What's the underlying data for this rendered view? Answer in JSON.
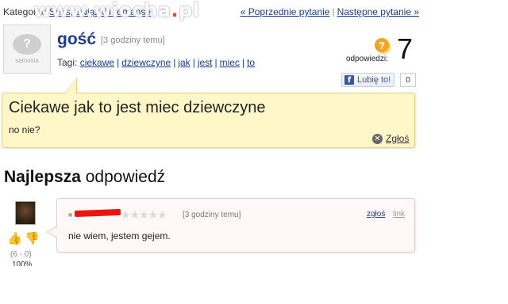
{
  "header": {
    "category_label": "Kategoria:",
    "category_link": "Seks, związki i romanse",
    "prev_link": "« Poprzednie pytanie",
    "next_link": "Następne pytanie »",
    "separator": "|"
  },
  "watermark": {
    "brand": "www.wiocha",
    "dot": ".",
    "tld": "pl"
  },
  "question": {
    "avatar_brand": "samosia",
    "author": "gość",
    "time": "[3 godziny temu]",
    "tags_label": "Tagi:",
    "tags": [
      "ciekawe",
      "dziewczyne",
      "jak",
      "jest",
      "miec",
      "to"
    ],
    "answers_label": "odpowiedzi:",
    "answers_icon_glyph": "?",
    "answers_count": "7",
    "like_label": "Lubię to!",
    "like_icon_glyph": "f",
    "like_count": "0",
    "title": "Ciekawe jak to jest miec dziewczyne",
    "body": "no nie?",
    "report_label": "Zgłoś",
    "report_icon_glyph": "✕"
  },
  "best_answer": {
    "heading_bold": "Najlepsza",
    "heading_rest": " odpowiedź",
    "time": "[3 godziny temu]",
    "stars": "★★★★★",
    "report_label": "zgłoś",
    "link_label": "link",
    "text": "nie wiem, jestem gejem.",
    "votes": "(6 - 0)",
    "percent": "100%",
    "thumb_up_glyph": "👍",
    "thumb_down_glyph": "👎"
  },
  "colors": {
    "question_bg": "#fff7c7",
    "answer_bg": "#fff8f8",
    "link": "#1a3b94",
    "accent_orange": "#f2a51d"
  }
}
